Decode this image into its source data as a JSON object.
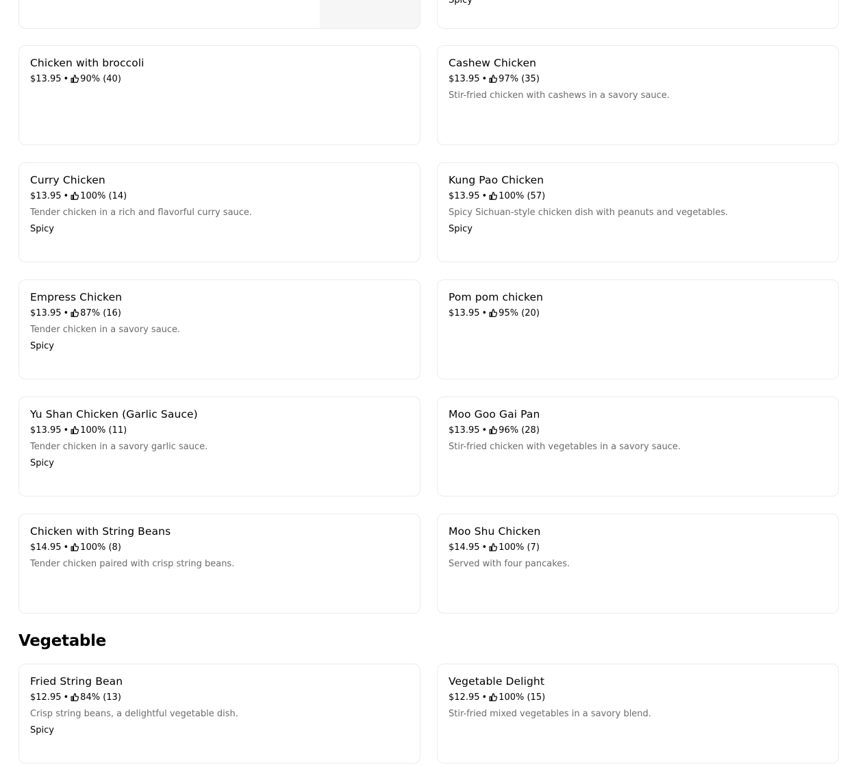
{
  "top_partial_cards": {
    "right_tag": "Spicy"
  },
  "sections": {
    "chicken": {
      "items": [
        {
          "name": "Chicken with broccoli",
          "price": "$13.95",
          "rating": "90% (40)",
          "description": "",
          "tag": ""
        },
        {
          "name": "Cashew Chicken",
          "price": "$13.95",
          "rating": "97% (35)",
          "description": "Stir-fried chicken with cashews in a savory sauce.",
          "tag": ""
        },
        {
          "name": "Curry Chicken",
          "price": "$13.95",
          "rating": "100% (14)",
          "description": "Tender chicken in a rich and flavorful curry sauce.",
          "tag": "Spicy"
        },
        {
          "name": "Kung Pao Chicken",
          "price": "$13.95",
          "rating": "100% (57)",
          "description": "Spicy Sichuan-style chicken dish with peanuts and vegetables.",
          "tag": "Spicy"
        },
        {
          "name": "Empress Chicken",
          "price": "$13.95",
          "rating": "87% (16)",
          "description": "Tender chicken in a savory sauce.",
          "tag": "Spicy"
        },
        {
          "name": "Pom pom chicken",
          "price": "$13.95",
          "rating": "95% (20)",
          "description": "",
          "tag": ""
        },
        {
          "name": "Yu Shan Chicken (Garlic Sauce)",
          "price": "$13.95",
          "rating": "100% (11)",
          "description": "Tender chicken in a savory garlic sauce.",
          "tag": "Spicy"
        },
        {
          "name": "Moo Goo Gai Pan",
          "price": "$13.95",
          "rating": "96% (28)",
          "description": "Stir-fried chicken with vegetables in a savory sauce.",
          "tag": ""
        },
        {
          "name": "Chicken with String Beans",
          "price": "$14.95",
          "rating": "100% (8)",
          "description": "Tender chicken paired with crisp string beans.",
          "tag": ""
        },
        {
          "name": "Moo Shu Chicken",
          "price": "$14.95",
          "rating": "100% (7)",
          "description": "Served with four pancakes.",
          "tag": ""
        }
      ]
    },
    "vegetable": {
      "title": "Vegetable",
      "items": [
        {
          "name": "Fried String Bean",
          "price": "$12.95",
          "rating": "84% (13)",
          "description": "Crisp string beans, a delightful vegetable dish.",
          "tag": "Spicy"
        },
        {
          "name": "Vegetable Delight",
          "price": "$12.95",
          "rating": "100% (15)",
          "description": "Stir-fried mixed vegetables in a savory blend.",
          "tag": ""
        }
      ]
    }
  },
  "separator": "•",
  "icons": {
    "rating": "thumbs-up-icon"
  },
  "colors": {
    "text": "#000000",
    "description": "#6b6b6b",
    "border": "#ececec",
    "image_placeholder": "#f6f6f6"
  }
}
